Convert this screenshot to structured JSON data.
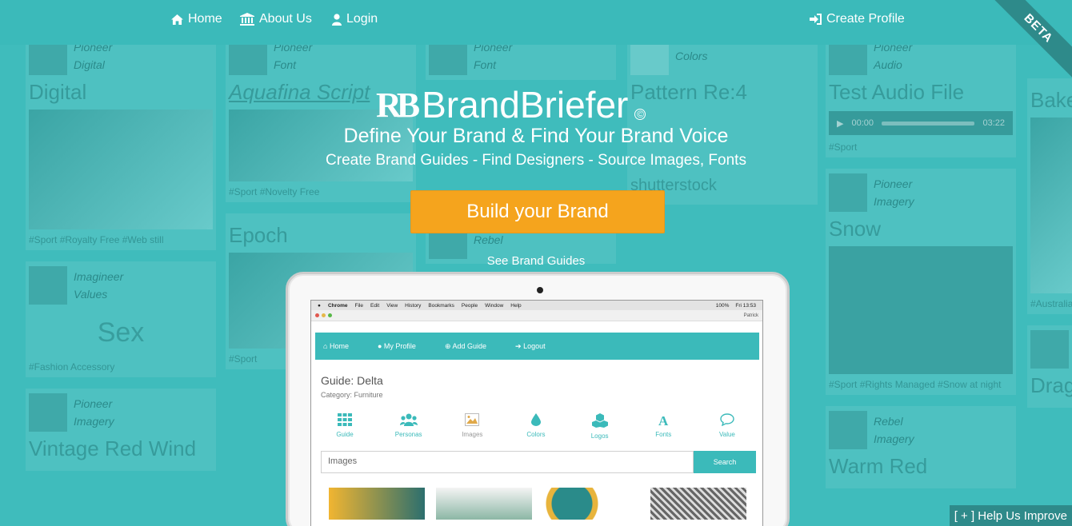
{
  "nav": {
    "home": "Home",
    "about": "About Us",
    "login": "Login",
    "create_profile": "Create Profile"
  },
  "ribbon": "BETA",
  "hero": {
    "brand": "BrandBriefer",
    "logo_mark": "RB",
    "copyright": "©",
    "tagline1": "Define Your Brand & Find Your Brand Voice",
    "tagline2": "Create Brand Guides - Find Designers - Source Images, Fonts",
    "cta": "Build your Brand",
    "see_guides": "See Brand Guides"
  },
  "mock": {
    "mac_menu": [
      "Chrome",
      "File",
      "Edit",
      "View",
      "History",
      "Bookmarks",
      "People",
      "Window",
      "Help"
    ],
    "mac_status": [
      "100%",
      "Fri 13:53"
    ],
    "browser_user": "Patrick",
    "app_nav": [
      "Home",
      "My Profile",
      "Add Guide",
      "Logout"
    ],
    "guide_title": "Guide: Delta",
    "guide_category": "Category: Furniture",
    "tabs": [
      "Guide",
      "Personas",
      "Images",
      "Colors",
      "Logos",
      "Fonts",
      "Value"
    ],
    "search_placeholder": "Images",
    "search_button": "Search"
  },
  "background": {
    "col1": {
      "meta1a": "Pioneer",
      "meta1b": "Digital",
      "title1": "Digital",
      "tags1": "#Sport  #Royalty Free  #Web still",
      "meta2a": "Imagineer",
      "meta2b": "Values",
      "big": "Sex",
      "tags2": "#Fashion Accessory",
      "meta3a": "Pioneer",
      "meta3b": "Imagery",
      "title3": "Vintage Red Wind"
    },
    "col2": {
      "meta1a": "Pioneer",
      "meta1b": "Font",
      "title1": "Aquafina Script",
      "tags1": "#Sport  #Novelty Free",
      "title2": "Epoch",
      "tags2": "#Sport"
    },
    "col3": {
      "meta1a": "Pioneer",
      "meta1b": "Font",
      "meta2a": "Rebel"
    },
    "col4": {
      "meta1b": "Colors",
      "title1": "Pattern Re:4",
      "title2": "shutterstock"
    },
    "col5": {
      "meta1a": "Pioneer",
      "meta1b": "Audio",
      "title1": "Test Audio File",
      "audio_start": "00:00",
      "audio_end": "03:22",
      "tags1": "#Sport",
      "meta2a": "Pioneer",
      "meta2b": "Imagery",
      "title2": "Snow",
      "tags2": "#Sport  #Rights Managed  #Snow at night",
      "meta3a": "Rebel",
      "meta3b": "Imagery",
      "title3": "Warm Red"
    },
    "col6": {
      "title1": "Bake",
      "tags1": "#Australia",
      "title2": "Drag"
    }
  },
  "help": "[ + ] Help Us Improve",
  "colors": {
    "primary": "#3bbaba",
    "cta": "#f5a41d",
    "ribbon": "#2e8a8a"
  }
}
